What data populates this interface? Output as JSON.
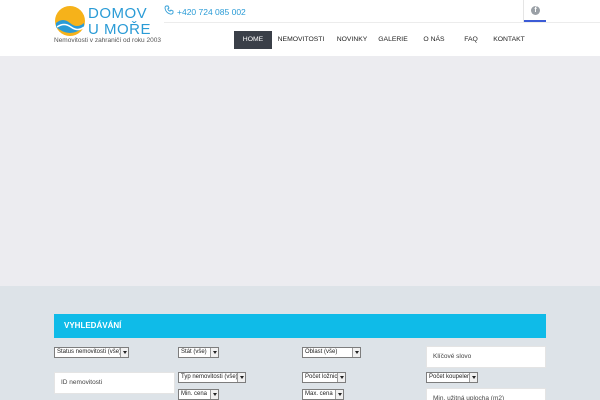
{
  "brand": {
    "name_line1": "DOMOV",
    "name_line2": "U MOŘE",
    "tagline": "Nemovitosti v zahraničí od roku 2003"
  },
  "contact": {
    "phone": "+420 724 085 002"
  },
  "social": {
    "facebook": "f"
  },
  "nav": {
    "items": [
      {
        "label": "HOME",
        "active": true
      },
      {
        "label": "NEMOVITOSTI"
      },
      {
        "label": "NOVINKY"
      },
      {
        "label": "GALERIE"
      },
      {
        "label": "O NÁS"
      },
      {
        "label": "FAQ"
      },
      {
        "label": "KONTAKT"
      }
    ]
  },
  "search": {
    "title": "VYHLEDÁVÁNÍ",
    "status": "Status nemovitosti (vše)",
    "country": "Stát (vše)",
    "region": "Oblast (vše)",
    "keyword_placeholder": "Klíčové slovo",
    "id_placeholder": "ID nemovitosti",
    "type": "Typ nemovitosti (vše)",
    "bedrooms": "Počet ložnic",
    "bathrooms": "Počet koupelen",
    "min_price": "Min. cena",
    "max_price": "Max. cena",
    "min_area_placeholder": "Min. užitná uplocha (m2)"
  },
  "colors": {
    "accent": "#0fbbe8",
    "brand_blue": "#2a9bd6",
    "nav_active": "#3a3f48",
    "social_underline": "#3b5bd6"
  }
}
